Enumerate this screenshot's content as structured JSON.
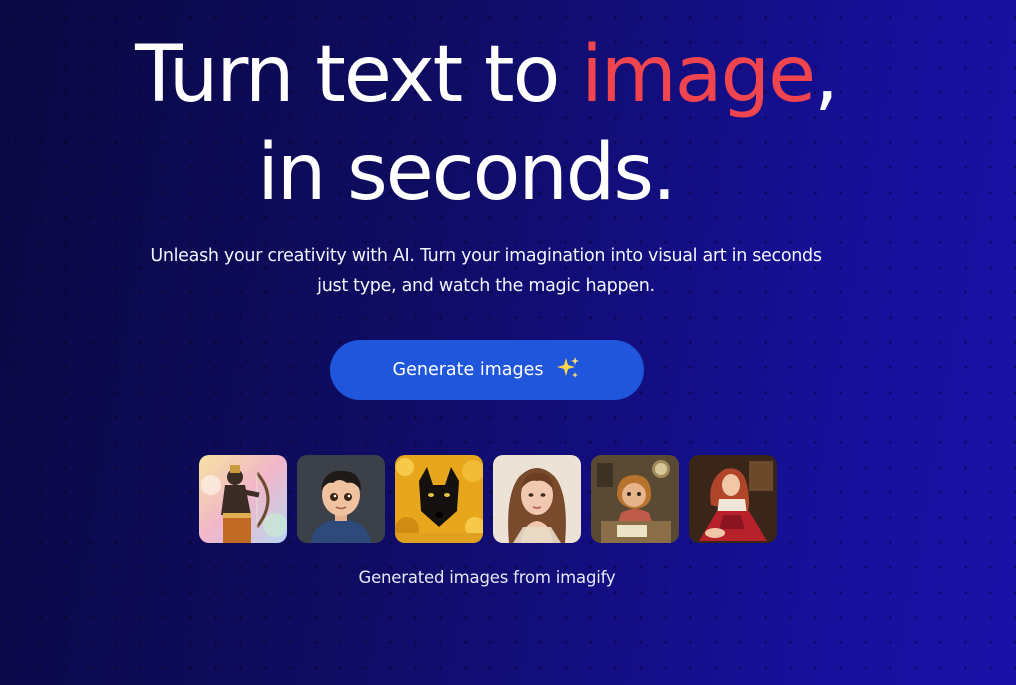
{
  "hero": {
    "headline_part1": "Turn text to ",
    "headline_accent": "image",
    "headline_part2": ",",
    "headline_line2": "in seconds.",
    "subtitle_line1": "Unleash your creativity with AI. Turn your imagination into visual art in seconds",
    "subtitle_line2": "just type, and watch the magic happen.",
    "cta_label": "Generate images",
    "cta_icon": "sparkles-icon",
    "caption": "Generated images from imagify"
  },
  "gallery": [
    {
      "name": "archer-warrior-image"
    },
    {
      "name": "cartoon-boy-image"
    },
    {
      "name": "black-wolf-image"
    },
    {
      "name": "woman-portrait-image"
    },
    {
      "name": "girl-writing-image"
    },
    {
      "name": "woman-red-dress-image"
    }
  ],
  "colors": {
    "background": "#0f0c63",
    "accent_text": "#f0454f",
    "button": "#1f56db",
    "sparkle": "#ffd54a"
  }
}
